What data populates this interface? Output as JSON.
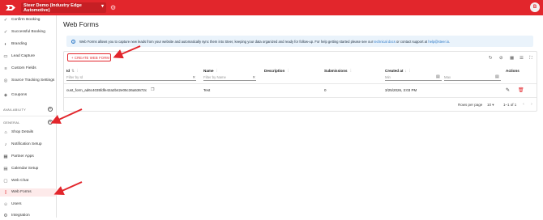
{
  "app": {
    "account_name": "Steer Demo (Industry Edge Automotive)",
    "avatar_initial": "B",
    "brand_color": "#e2262c"
  },
  "sidebar": {
    "items_top": [
      {
        "label": "Confirm Booking",
        "icon": "check-circle-icon"
      },
      {
        "label": "Successful Booking",
        "icon": "check-circle-icon"
      },
      {
        "label": "Branding",
        "icon": "palette-icon"
      },
      {
        "label": "Lead Capture",
        "icon": "card-icon"
      },
      {
        "label": "Custom Fields",
        "icon": "list-icon"
      },
      {
        "label": "Source Tracking Settings",
        "icon": "tracking-icon"
      },
      {
        "label": "Coupons",
        "icon": "coupon-icon"
      }
    ],
    "section_availability": "AVAILABILITY",
    "section_general": "GENERAL",
    "items_general": [
      {
        "label": "Shop Details",
        "icon": "shop-icon"
      },
      {
        "label": "Notification Setup",
        "icon": "bell-icon"
      },
      {
        "label": "Partner Apps",
        "icon": "grid-icon"
      },
      {
        "label": "Calendar Setup",
        "icon": "calendar-icon"
      },
      {
        "label": "Web Chat",
        "icon": "chat-icon"
      },
      {
        "label": "Web Forms",
        "icon": "form-icon",
        "active": true
      },
      {
        "label": "Users",
        "icon": "users-icon"
      },
      {
        "label": "Integration",
        "icon": "integration-icon"
      }
    ]
  },
  "main": {
    "title": "Web Forms",
    "info": {
      "text": "Web Forms allows you to capture new leads from your website and automatically sync them into Steer, keeping your data organized and ready for follow-up. For help getting started please see our",
      "link1": "technical docs",
      "middle": "or contact support at",
      "link2": "help@steer.io",
      "end": "."
    },
    "create_button": "+ CREATE WEB FORM",
    "table": {
      "columns": {
        "id": "Id",
        "name": "Name",
        "description": "Description",
        "submissions": "Submissions",
        "created_at": "Created at",
        "actions": "Actions"
      },
      "filters": {
        "id_placeholder": "Filter by Id",
        "name_placeholder": "Filter by Name",
        "min_placeholder": "Min",
        "max_placeholder": "Max"
      },
      "rows": [
        {
          "id": "cust_form_ad6c4035fdfe42a2b42e05c36a53672c",
          "name": "Test",
          "description": "",
          "submissions": "0",
          "created_at": "3/25/2026, 3:03 PM"
        }
      ]
    },
    "footer": {
      "rows_per_page_label": "Rows per page",
      "rows_per_page_value": "10",
      "range": "1–1 of 1"
    }
  }
}
